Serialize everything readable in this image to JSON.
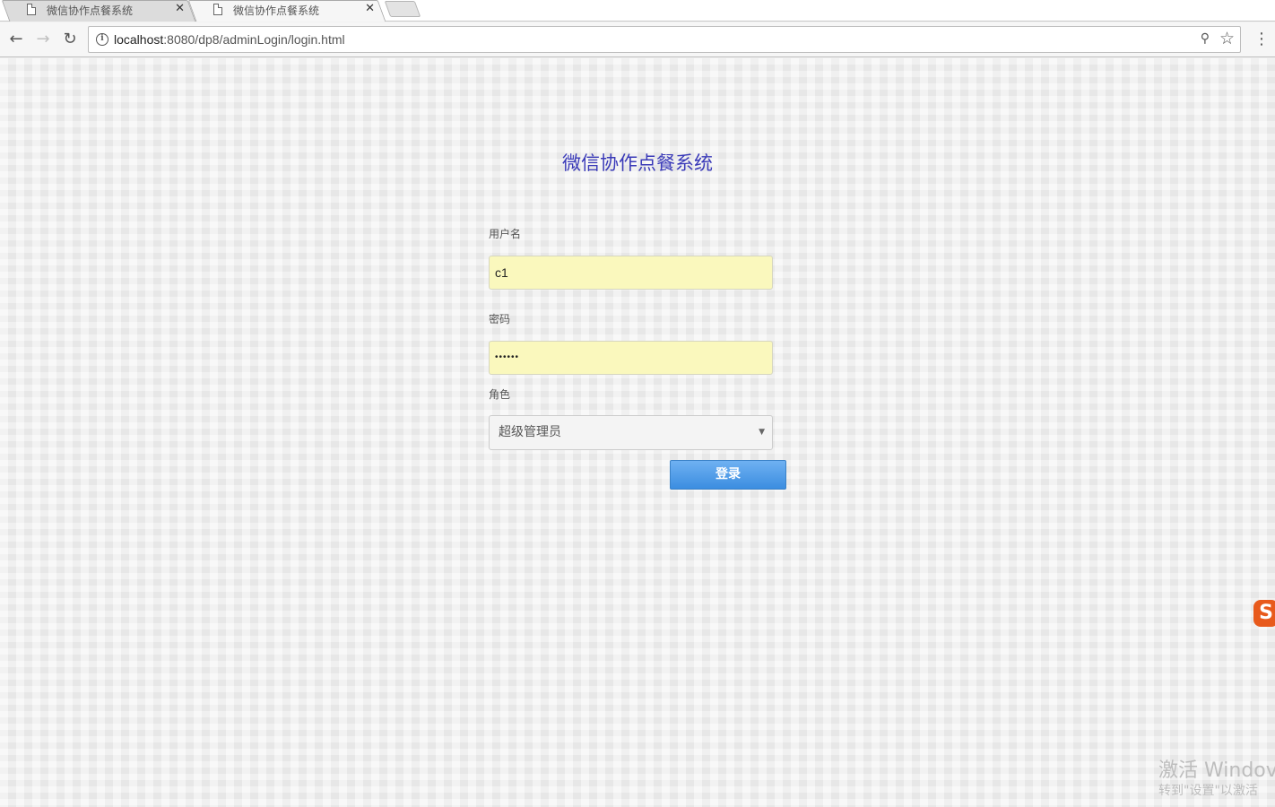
{
  "browser": {
    "tabs": [
      {
        "title": "微信协作点餐系统",
        "close": "✕",
        "active": false
      },
      {
        "title": "微信协作点餐系统",
        "close": "✕",
        "active": true
      }
    ],
    "address": {
      "host": "localhost",
      "rest": ":8080/dp8/adminLogin/login.html"
    },
    "icons": {
      "back": "back-arrow-icon",
      "forward": "forward-arrow-icon",
      "reload": "reload-icon",
      "info": "info-icon",
      "key": "key-icon",
      "star": "star-icon",
      "menu": "kebab-menu-icon"
    }
  },
  "login": {
    "title": "微信协作点餐系统",
    "username_label": "用户名",
    "username_value": "c1",
    "password_label": "密码",
    "password_value": "••••••",
    "role_label": "角色",
    "role_selected": "超级管理员",
    "submit_label": "登录"
  },
  "overlay": {
    "ime_icon": "S",
    "watermark_title": "激活 Windov",
    "watermark_sub": "转到\"设置\"以激活"
  },
  "colors": {
    "title": "#3a3ab8",
    "input_autofill": "#faf8bd",
    "button": "#4a97e6"
  }
}
